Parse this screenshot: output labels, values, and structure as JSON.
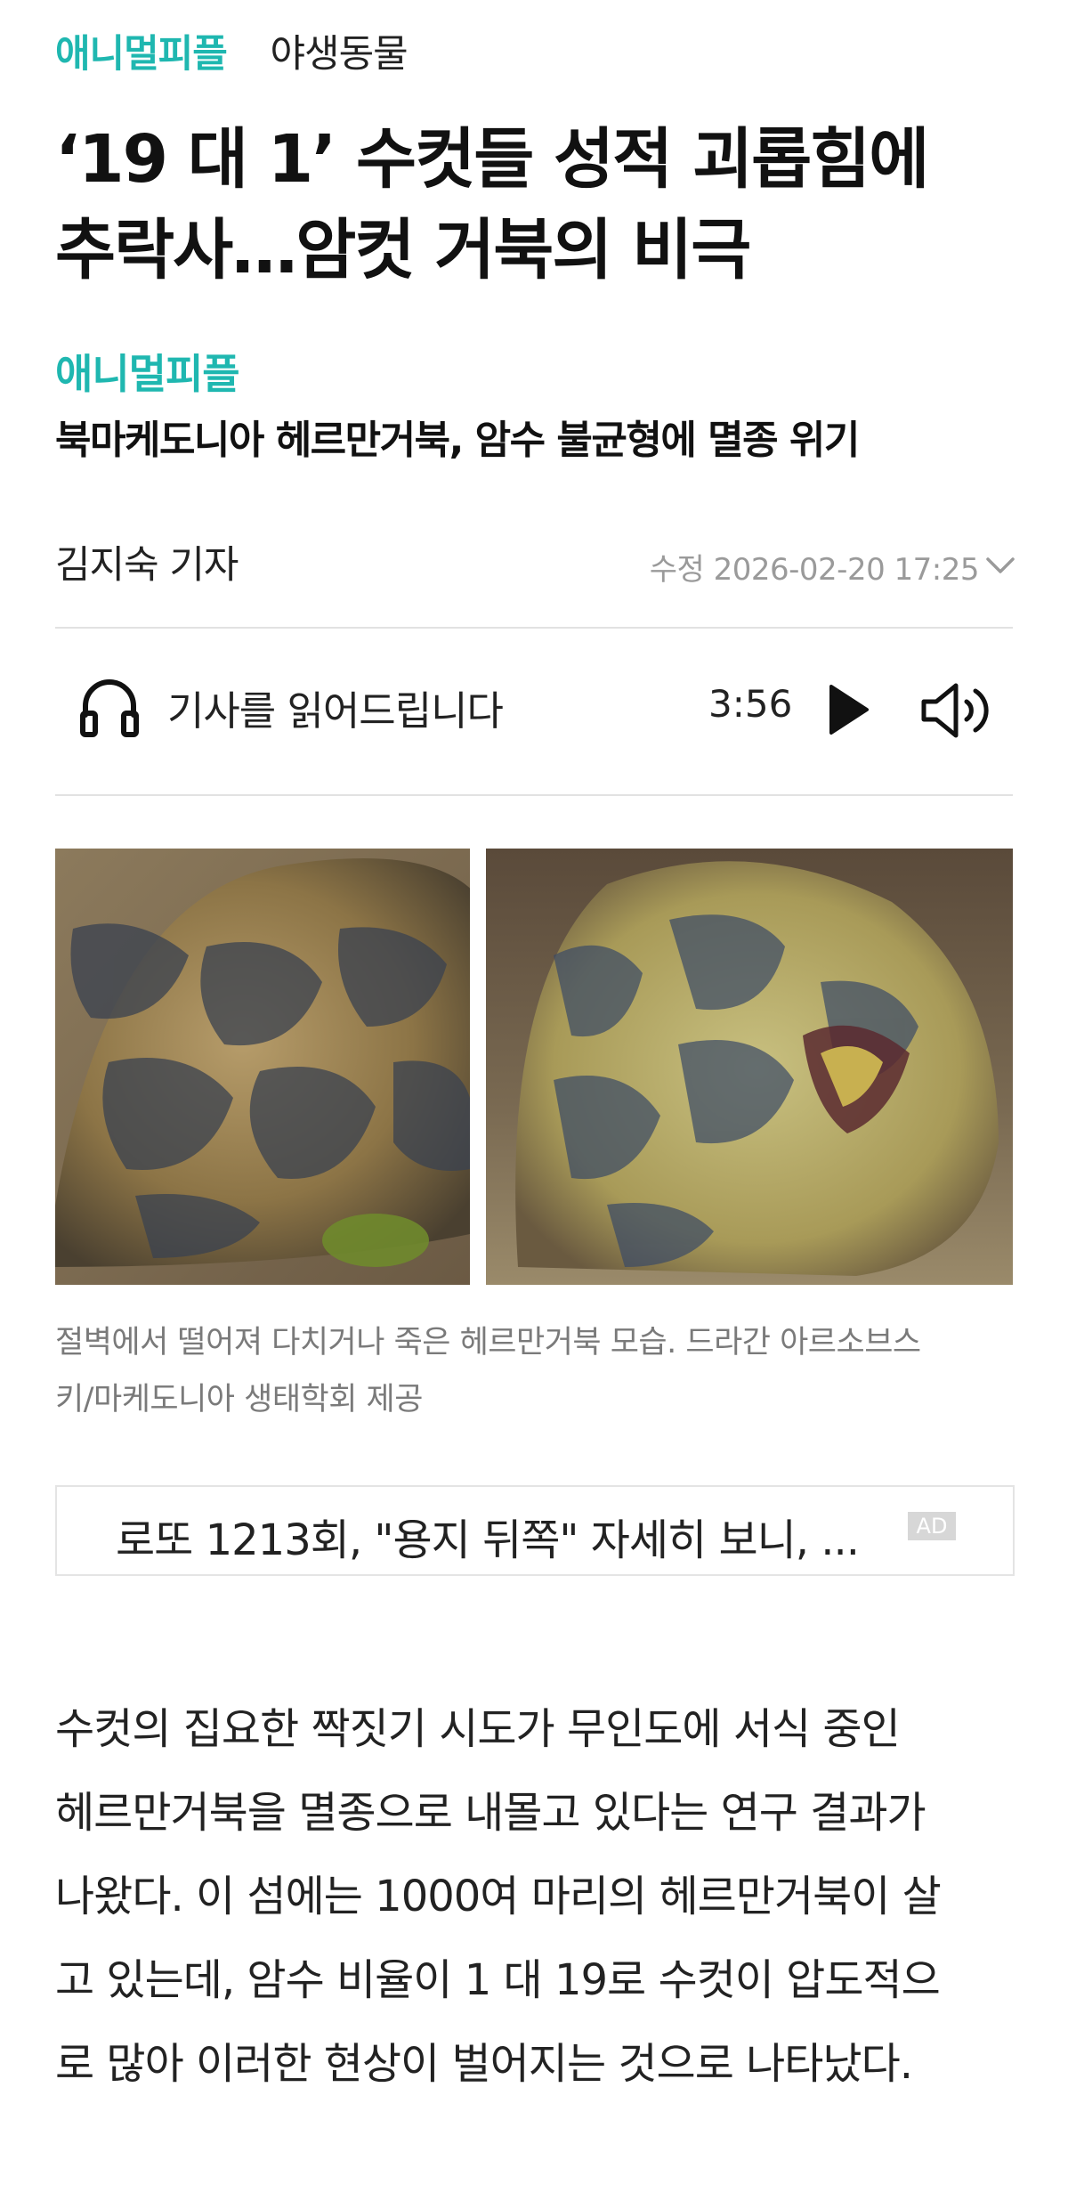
{
  "category": {
    "section": "애니멀피플",
    "subsection": "야생동물"
  },
  "headline": {
    "line1": "‘19 대 1’ 수컷들 성적 괴롭힘에",
    "line2": "추락사…암컷 거북의 비극"
  },
  "series": "애니멀피플",
  "subhead": "북마케도니아 헤르만거북, 암수 불균형에 멸종 위기",
  "byline": "김지숙 기자",
  "updated": "수정 2026-02-20 17:25",
  "tts": {
    "label": "기사를 읽어드립니다",
    "duration": "3:56",
    "icons": [
      "headphones-icon",
      "play-icon",
      "speaker-icon"
    ]
  },
  "photo": {
    "caption_line1": "절벽에서 떨어져 다치거나 죽은 헤르만거북 모습. 드라간 아르소브스",
    "caption_line2": "키/마케도니아 생태학회 제공"
  },
  "ad": {
    "text": "로또 1213회, \"용지 뒤쪽\" 자세히 보니, ...",
    "badge": "AD"
  },
  "body": {
    "line1": "수컷의 집요한 짝짓기 시도가 무인도에 서식 중인",
    "line2": "헤르만거북을 멸종으로 내몰고 있다는 연구 결과가",
    "line3": "나왔다. 이 섬에는 1000여 마리의 헤르만거북이 살",
    "line4": "고 있는데, 암수 비율이 1 대 19로 수컷이 압도적으",
    "line5": "로 많아 이러한 현상이 벌어지는 것으로 나타났다."
  },
  "colors": {
    "accent": "#1fb7b0",
    "text": "#111111",
    "muted": "#9a9a9a",
    "divider": "#e2e2e2"
  }
}
